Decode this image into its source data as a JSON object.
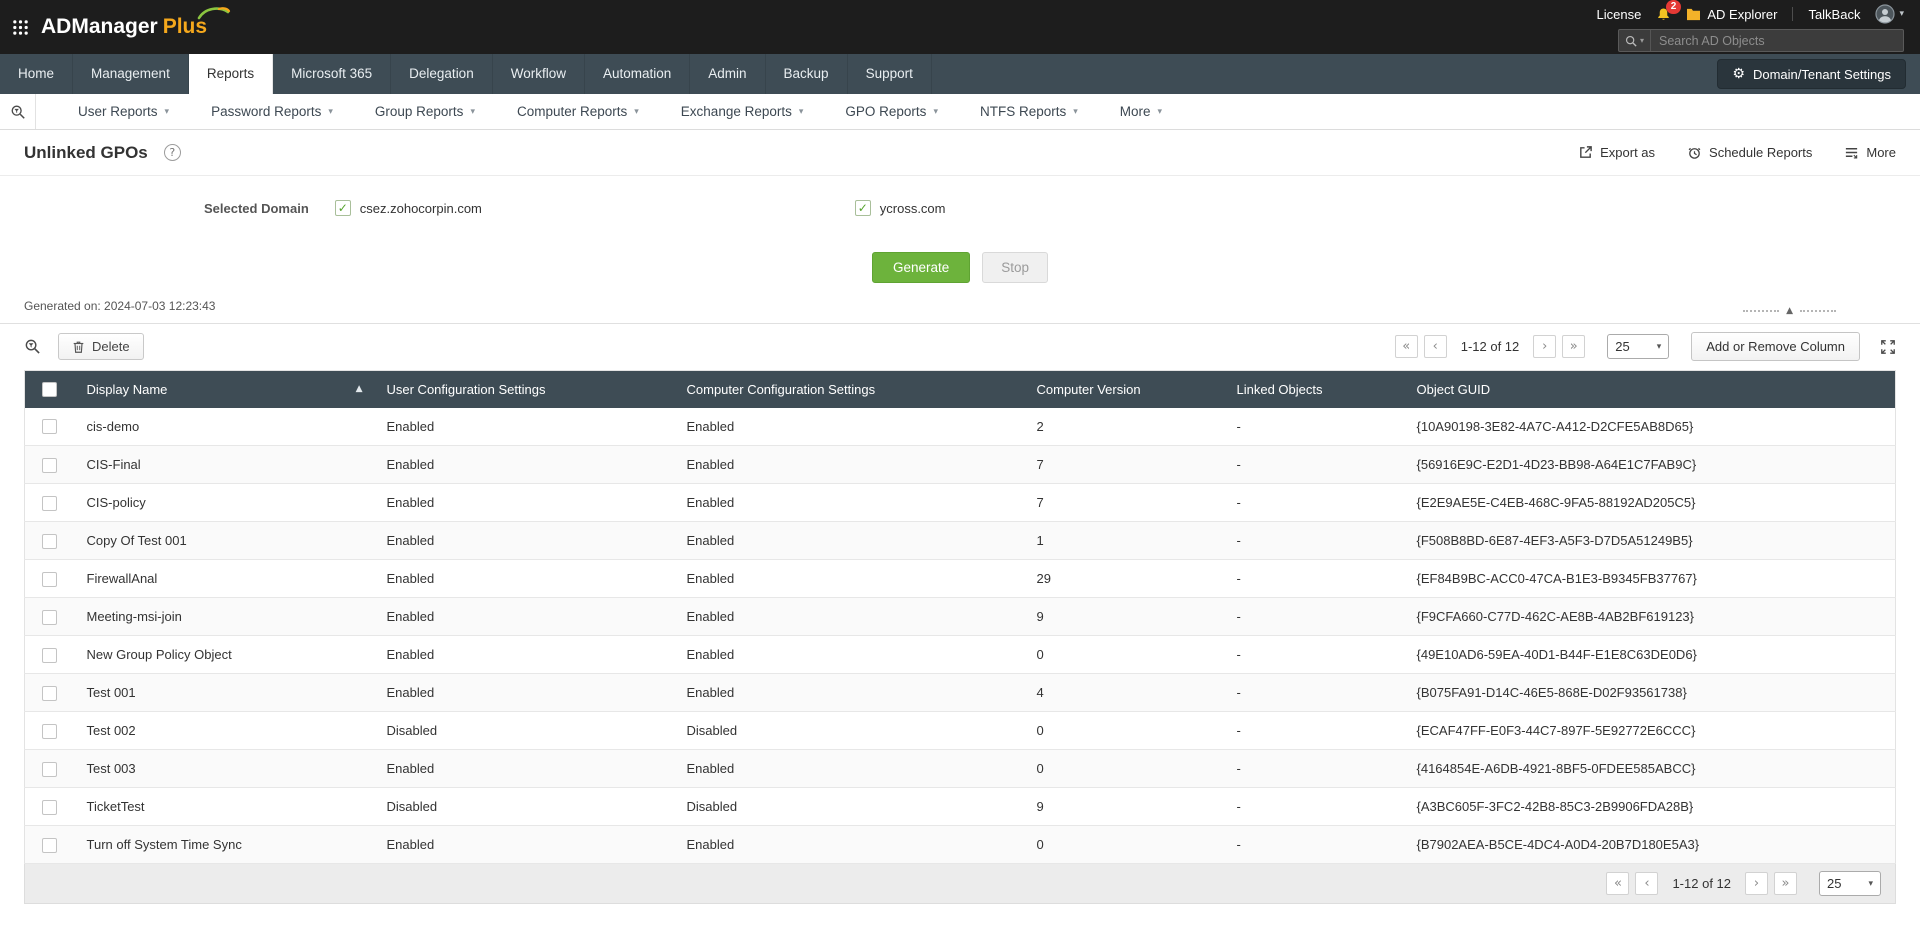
{
  "icons": {
    "caret_down": "▾",
    "sort_asc": "▲",
    "collapse_up": "▲",
    "gear": "⚙",
    "help": "?",
    "first": "«",
    "prev": "‹",
    "next": "›",
    "last": "»"
  },
  "colors": {
    "accent_green": "#6db33c",
    "slate": "#3e4c55",
    "topbar": "#1d1d1d",
    "badge_red": "#e53935",
    "logo_orange": "#f5a81c"
  },
  "topbar": {
    "brand_name": "ADManager",
    "brand_suffix": "Plus",
    "license": "License",
    "notification_count": "2",
    "ad_explorer": "AD Explorer",
    "talkback": "TalkBack",
    "search_placeholder": "Search AD Objects"
  },
  "nav": {
    "tabs": [
      {
        "label": "Home"
      },
      {
        "label": "Management"
      },
      {
        "label": "Reports",
        "active": true
      },
      {
        "label": "Microsoft 365"
      },
      {
        "label": "Delegation"
      },
      {
        "label": "Workflow"
      },
      {
        "label": "Automation"
      },
      {
        "label": "Admin"
      },
      {
        "label": "Backup"
      },
      {
        "label": "Support"
      }
    ],
    "settings_button": "Domain/Tenant Settings"
  },
  "report_nav": {
    "items": [
      "User Reports",
      "Password Reports",
      "Group Reports",
      "Computer Reports",
      "Exchange Reports",
      "GPO Reports",
      "NTFS Reports",
      "More"
    ]
  },
  "page": {
    "title": "Unlinked GPOs",
    "export": "Export as",
    "schedule": "Schedule Reports",
    "more": "More"
  },
  "form": {
    "label": "Selected Domain",
    "domains": [
      {
        "name": "csez.zohocorpin.com",
        "checked": true
      },
      {
        "name": "ycross.com",
        "checked": true
      }
    ],
    "generate": "Generate",
    "stop": "Stop",
    "generated_on": "Generated on: 2024-07-03 12:23:43"
  },
  "toolbar": {
    "delete": "Delete",
    "range": "1-12 of 12",
    "page_size": "25",
    "add_remove_column": "Add or Remove Column"
  },
  "table": {
    "columns": [
      "Display Name",
      "User Configuration Settings",
      "Computer Configuration Settings",
      "Computer Version",
      "Linked Objects",
      "Object GUID"
    ],
    "rows": [
      {
        "display_name": "cis-demo",
        "user_config": "Enabled",
        "computer_config": "Enabled",
        "computer_version": "2",
        "linked_objects": "-",
        "guid": "{10A90198-3E82-4A7C-A412-D2CFE5AB8D65}"
      },
      {
        "display_name": "CIS-Final",
        "user_config": "Enabled",
        "computer_config": "Enabled",
        "computer_version": "7",
        "linked_objects": "-",
        "guid": "{56916E9C-E2D1-4D23-BB98-A64E1C7FAB9C}"
      },
      {
        "display_name": "CIS-policy",
        "user_config": "Enabled",
        "computer_config": "Enabled",
        "computer_version": "7",
        "linked_objects": "-",
        "guid": "{E2E9AE5E-C4EB-468C-9FA5-88192AD205C5}"
      },
      {
        "display_name": "Copy Of Test 001",
        "user_config": "Enabled",
        "computer_config": "Enabled",
        "computer_version": "1",
        "linked_objects": "-",
        "guid": "{F508B8BD-6E87-4EF3-A5F3-D7D5A51249B5}"
      },
      {
        "display_name": "FirewallAnal",
        "user_config": "Enabled",
        "computer_config": "Enabled",
        "computer_version": "29",
        "linked_objects": "-",
        "guid": "{EF84B9BC-ACC0-47CA-B1E3-B9345FB37767}"
      },
      {
        "display_name": "Meeting-msi-join",
        "user_config": "Enabled",
        "computer_config": "Enabled",
        "computer_version": "9",
        "linked_objects": "-",
        "guid": "{F9CFA660-C77D-462C-AE8B-4AB2BF619123}"
      },
      {
        "display_name": "New Group Policy Object",
        "user_config": "Enabled",
        "computer_config": "Enabled",
        "computer_version": "0",
        "linked_objects": "-",
        "guid": "{49E10AD6-59EA-40D1-B44F-E1E8C63DE0D6}"
      },
      {
        "display_name": "Test 001",
        "user_config": "Enabled",
        "computer_config": "Enabled",
        "computer_version": "4",
        "linked_objects": "-",
        "guid": "{B075FA91-D14C-46E5-868E-D02F93561738}"
      },
      {
        "display_name": "Test 002",
        "user_config": "Disabled",
        "computer_config": "Disabled",
        "computer_version": "0",
        "linked_objects": "-",
        "guid": "{ECAF47FF-E0F3-44C7-897F-5E92772E6CCC}"
      },
      {
        "display_name": "Test 003",
        "user_config": "Enabled",
        "computer_config": "Enabled",
        "computer_version": "0",
        "linked_objects": "-",
        "guid": "{4164854E-A6DB-4921-8BF5-0FDEE585ABCC}"
      },
      {
        "display_name": "TicketTest",
        "user_config": "Disabled",
        "computer_config": "Disabled",
        "computer_version": "9",
        "linked_objects": "-",
        "guid": "{A3BC605F-3FC2-42B8-85C3-2B9906FDA28B}"
      },
      {
        "display_name": "Turn off System Time Sync",
        "user_config": "Enabled",
        "computer_config": "Enabled",
        "computer_version": "0",
        "linked_objects": "-",
        "guid": "{B7902AEA-B5CE-4DC4-A0D4-20B7D180E5A3}"
      }
    ]
  },
  "footer": {
    "range": "1-12 of 12",
    "page_size": "25"
  }
}
